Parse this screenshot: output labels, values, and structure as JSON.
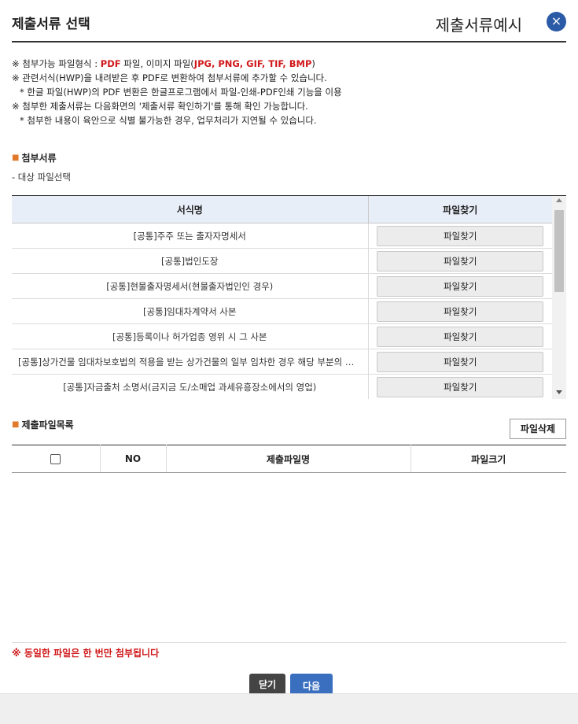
{
  "header": {
    "title": "제출서류 선택",
    "example_link": "제출서류예시",
    "close_symbol": "×"
  },
  "notes": {
    "line1_prefix": "※ 첨부가능 파일형식 : ",
    "line1_pdf": "PDF",
    "line1_mid": " 파일, 이미지 파일(",
    "line1_formats": "JPG, PNG, GIF, TIF, BMP",
    "line1_suffix": ")",
    "line2": "※ 관련서식(HWP)을 내려받은 후 PDF로 변환하여 첨부서류에 추가할 수 있습니다.",
    "line3": "* 한글 파일(HWP)의 PDF 변환은 한글프로그램에서 파일-인쇄-PDF인쇄 기능을 이용",
    "line4": "※ 첨부한 제출서류는 다음화면의 '제출서류 확인하기'를 통해 확인 가능합니다.",
    "line5": "* 첨부한 내용이 육안으로 식별 불가능한 경우, 업무처리가 지연될 수 있습니다."
  },
  "attach_section": {
    "title": "첨부서류",
    "subtitle": "- 대상 파일선택",
    "columns": [
      "서식명",
      "파일찾기"
    ],
    "find_label": "파일찾기",
    "rows": [
      {
        "name": "[공통]주주 또는 출자자명세서"
      },
      {
        "name": "[공통]법인도장"
      },
      {
        "name": "[공통]현물출자명세서(현물출자법인인 경우)"
      },
      {
        "name": "[공통]임대차계약서 사본"
      },
      {
        "name": "[공통]등록이나 허가업종 영위 시 그 사본"
      },
      {
        "name": "[공통]상가건물 임대차보호법의 적용을 받는 상가건물의 일부 임차한 경우 해당 부분의 도면"
      },
      {
        "name": "[공통]자금출처 소명서(금지금 도/소매업 과세유흥장소에서의 영업)"
      }
    ]
  },
  "files_section": {
    "title": "제출파일목록",
    "delete_label": "파일삭제",
    "columns": [
      "",
      "NO",
      "제출파일명",
      "파일크기"
    ]
  },
  "footer": {
    "warning": "※ 동일한 파일은 한 번만 첨부됩니다",
    "close_label": "닫기",
    "next_label": "다음"
  },
  "colors": {
    "accent_blue": "#2b5aa6",
    "highlight_red": "#d0181a",
    "bullet_orange": "#e07a2a"
  }
}
